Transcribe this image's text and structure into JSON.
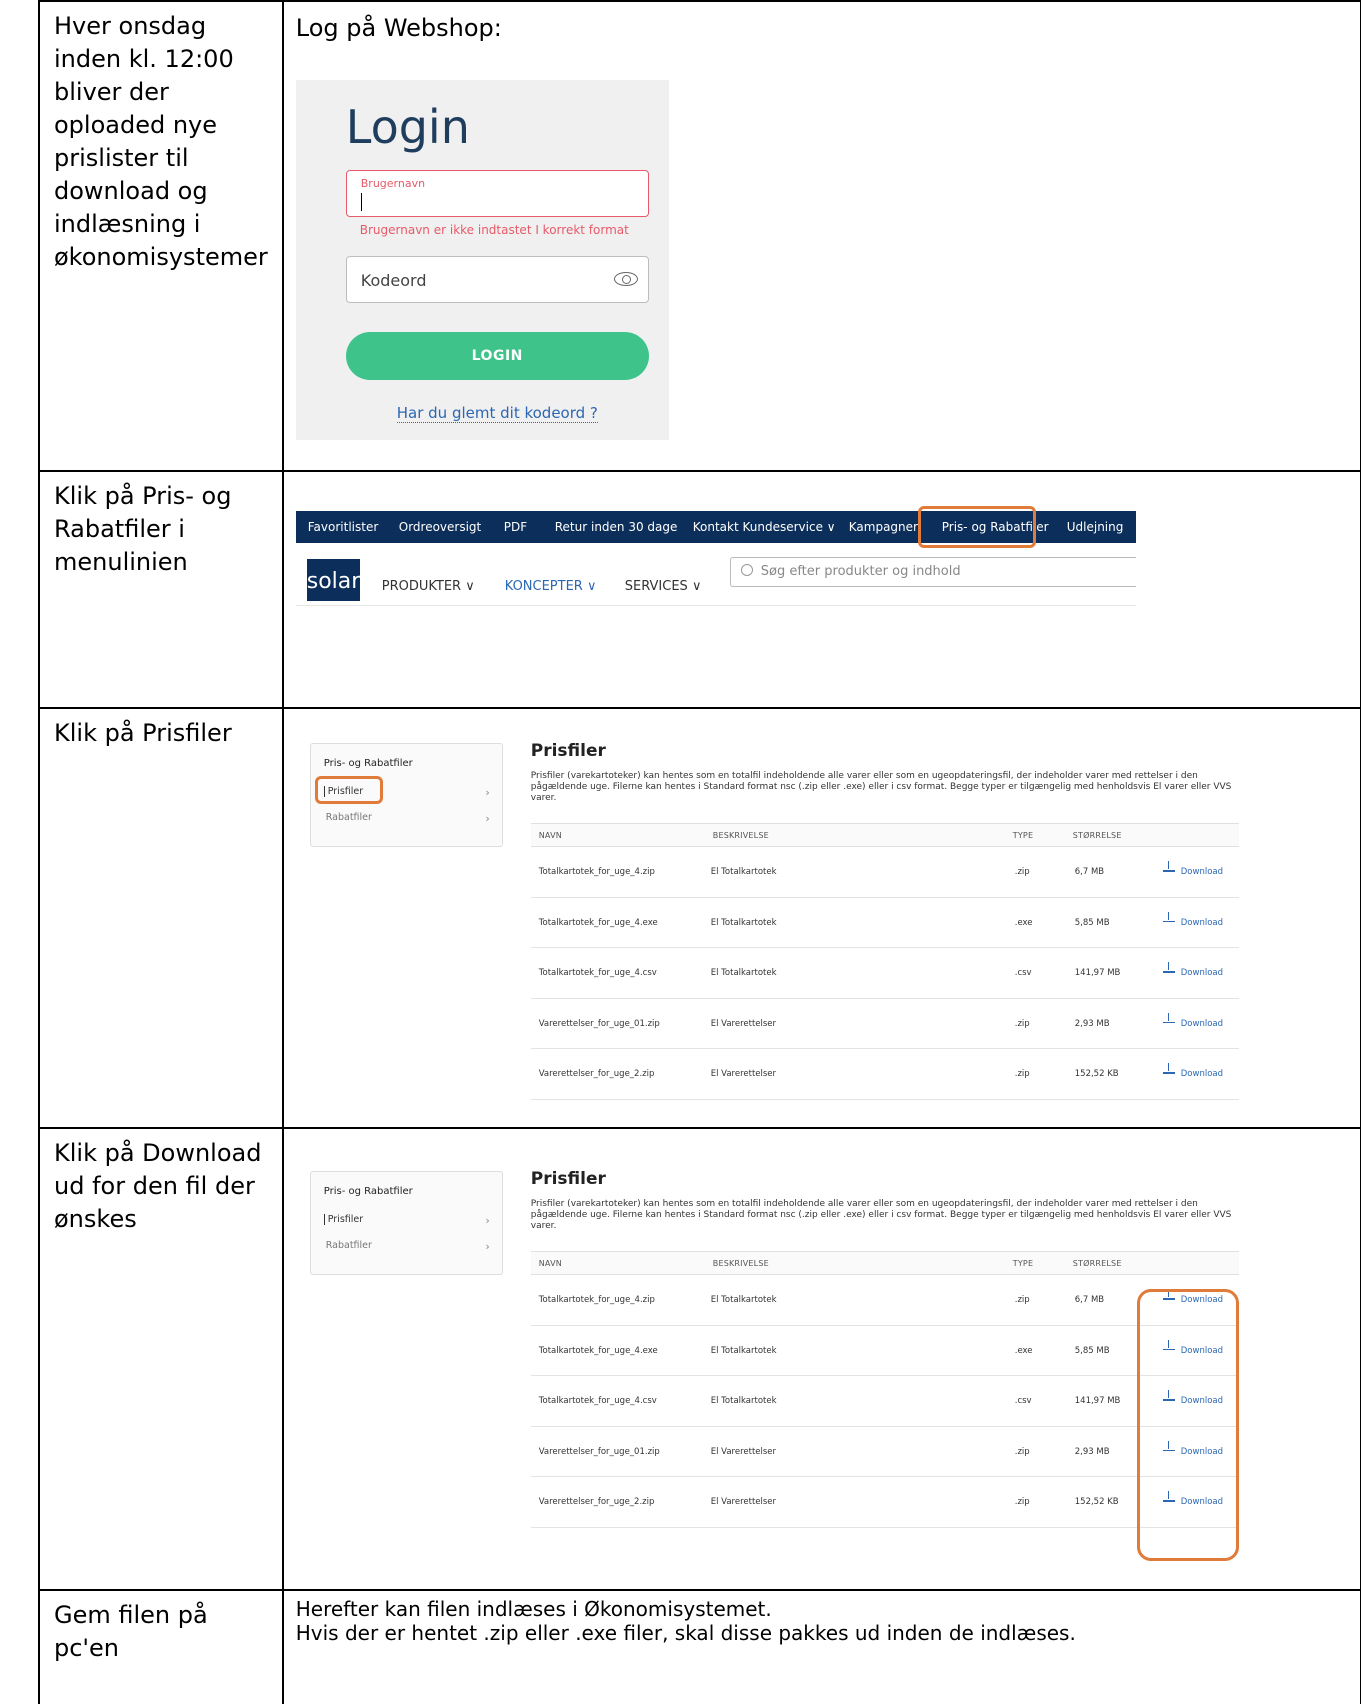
{
  "rows": [
    {
      "left": "Hver onsdag inden kl. 12:00 bliver der oploaded nye prislister til download og indlæsning i økonomisystemer",
      "right_heading": "Log på Webshop:"
    },
    {
      "left": "Klik på Pris- og Rabatfiler i menulinien"
    },
    {
      "left": "Klik på Prisfiler"
    },
    {
      "left": "Klik på Download ud for den fil der ønskes"
    },
    {
      "left": "Gem filen på pc'en",
      "right_line1": "Herefter kan filen indlæses i Økonomisystemet.",
      "right_line2": "Hvis der er hentet .zip eller .exe filer, skal disse pakkes ud inden de indlæses."
    }
  ],
  "login": {
    "title": "Login",
    "username_label": "Brugernavn",
    "username_error": "Brugernavn er ikke indtastet I korrekt format",
    "password_placeholder": "Kodeord",
    "button": "LOGIN",
    "forgot": "Har du glemt dit kodeord ?"
  },
  "menu": {
    "items": [
      "Favoritlister",
      "Ordreoversigt",
      "PDF",
      "Retur inden 30 dage",
      "Kontakt Kundeservice ∨",
      "Kampagner",
      "Pris- og Rabatfiler",
      "Udlejning"
    ],
    "logo": "solar",
    "nav": [
      "PRODUKTER ∨",
      "KONCEPTER ∨",
      "SERVICES ∨"
    ],
    "search_placeholder": "Søg efter produkter og indhold"
  },
  "prisfiler": {
    "side_heading": "Pris- og Rabatfiler",
    "side_items": [
      "Prisfiler",
      "Rabatfiler"
    ],
    "title": "Prisfiler",
    "description": "Prisfiler (varekartoteker) kan hentes som en totalfil indeholdende alle varer eller som en ugeopdateringsfil, der indeholder varer med rettelser i den pågældende uge. Filerne kan hentes i Standard format nsc (.zip eller .exe) eller i csv format. Begge typer er tilgængelig med henholdsvis El varer eller VVS varer.",
    "columns": [
      "NAVN",
      "BESKRIVELSE",
      "TYPE",
      "STØRRELSE"
    ],
    "files": [
      {
        "name": "Totalkartotek_for_uge_4.zip",
        "desc": "El Totalkartotek",
        "type": ".zip",
        "size": "6,7 MB",
        "action": "Download"
      },
      {
        "name": "Totalkartotek_for_uge_4.exe",
        "desc": "El Totalkartotek",
        "type": ".exe",
        "size": "5,85 MB",
        "action": "Download"
      },
      {
        "name": "Totalkartotek_for_uge_4.csv",
        "desc": "El Totalkartotek",
        "type": ".csv",
        "size": "141,97 MB",
        "action": "Download"
      },
      {
        "name": "Varerettelser_for_uge_01.zip",
        "desc": "El Varerettelser",
        "type": ".zip",
        "size": "2,93 MB",
        "action": "Download"
      },
      {
        "name": "Varerettelser_for_uge_2.zip",
        "desc": "El Varerettelser",
        "type": ".zip",
        "size": "152,52 KB",
        "action": "Download"
      }
    ]
  },
  "colors": {
    "highlight": "#e07b39",
    "navy": "#0c2e5a",
    "green": "#3ec48a",
    "error": "#e85a6a",
    "link": "#2b67b3"
  }
}
